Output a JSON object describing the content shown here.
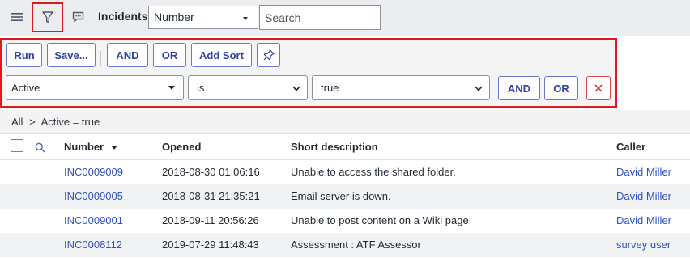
{
  "header": {
    "icons": [
      "hamburger-menu-icon",
      "filter-icon",
      "chat-bubble-icon"
    ],
    "title": "Incidents",
    "field_select": {
      "value": "Number"
    },
    "search": {
      "placeholder": "Search",
      "value": ""
    }
  },
  "filter": {
    "run_label": "Run",
    "save_label": "Save...",
    "and_label": "AND",
    "or_label": "OR",
    "add_sort_label": "Add Sort",
    "pin_icon": "pin-icon",
    "condition": {
      "field": "Active",
      "operator": "is",
      "value": "true",
      "and_label": "AND",
      "or_label": "OR",
      "delete_icon": "close-icon"
    }
  },
  "breadcrumb": {
    "root": "All",
    "separator": ">",
    "condition": "Active = true"
  },
  "table": {
    "columns": {
      "number": "Number",
      "opened": "Opened",
      "short_description": "Short description",
      "caller": "Caller"
    },
    "sort_indicator": "caret-down-icon",
    "rows": [
      {
        "number": "INC0009009",
        "opened": "2018-08-30 01:06:16",
        "short_description": "Unable to access the shared folder.",
        "caller": "David Miller"
      },
      {
        "number": "INC0009005",
        "opened": "2018-08-31 21:35:21",
        "short_description": "Email server is down.",
        "caller": "David Miller"
      },
      {
        "number": "INC0009001",
        "opened": "2018-09-11 20:56:26",
        "short_description": "Unable to post content on a Wiki page",
        "caller": "David Miller"
      },
      {
        "number": "INC0008112",
        "opened": "2019-07-29 11:48:43",
        "short_description": "Assessment : ATF Assessor",
        "caller": "survey user"
      }
    ]
  },
  "colors": {
    "accent": "#2f3fa8",
    "link": "#2f52c6",
    "highlight": "#e0191b",
    "delete": "#c62828"
  }
}
